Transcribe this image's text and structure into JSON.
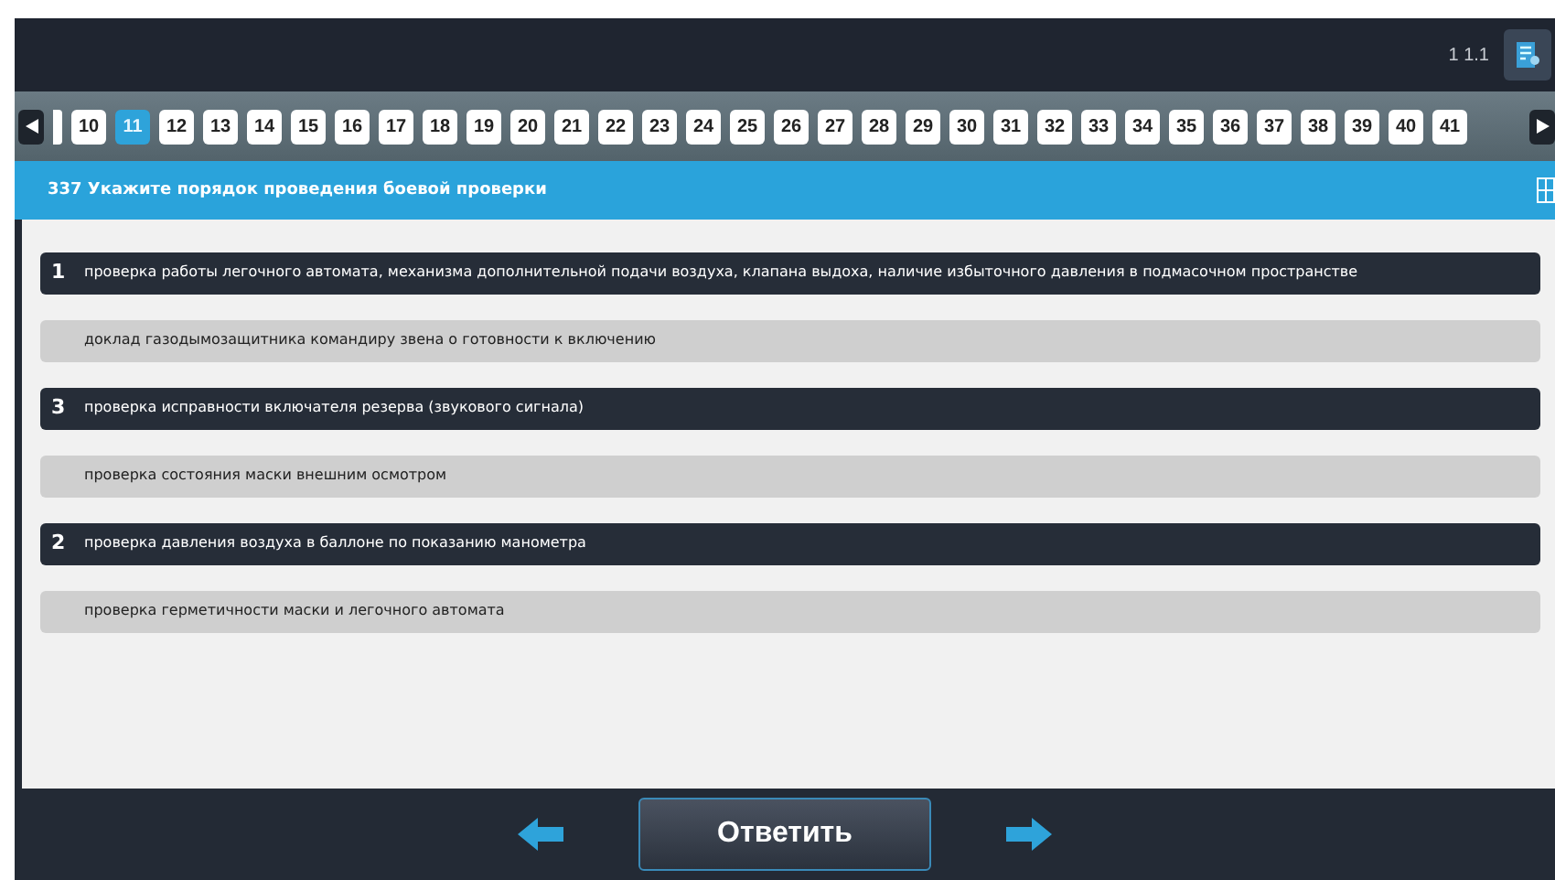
{
  "header": {
    "version": "1 1.1"
  },
  "pager": {
    "pages": [
      {
        "label": "10",
        "selected": false
      },
      {
        "label": "11",
        "selected": true
      },
      {
        "label": "12",
        "selected": false
      },
      {
        "label": "13",
        "selected": false
      },
      {
        "label": "14",
        "selected": false
      },
      {
        "label": "15",
        "selected": false
      },
      {
        "label": "16",
        "selected": false
      },
      {
        "label": "17",
        "selected": false
      },
      {
        "label": "18",
        "selected": false
      },
      {
        "label": "19",
        "selected": false
      },
      {
        "label": "20",
        "selected": false
      },
      {
        "label": "21",
        "selected": false
      },
      {
        "label": "22",
        "selected": false
      },
      {
        "label": "23",
        "selected": false
      },
      {
        "label": "24",
        "selected": false
      },
      {
        "label": "25",
        "selected": false
      },
      {
        "label": "26",
        "selected": false
      },
      {
        "label": "27",
        "selected": false
      },
      {
        "label": "28",
        "selected": false
      },
      {
        "label": "29",
        "selected": false
      },
      {
        "label": "30",
        "selected": false
      },
      {
        "label": "31",
        "selected": false
      },
      {
        "label": "32",
        "selected": false
      },
      {
        "label": "33",
        "selected": false
      },
      {
        "label": "34",
        "selected": false
      },
      {
        "label": "35",
        "selected": false
      },
      {
        "label": "36",
        "selected": false
      },
      {
        "label": "37",
        "selected": false
      },
      {
        "label": "38",
        "selected": false
      },
      {
        "label": "39",
        "selected": false
      },
      {
        "label": "40",
        "selected": false
      },
      {
        "label": "41",
        "selected": false
      }
    ]
  },
  "question": {
    "title": "337 Укажите порядок проведения боевой проверки"
  },
  "answers": [
    {
      "text": "проверка работы легочного автомата, механизма дополнительной подачи воздуха, клапана выдоха, наличие избыточного давления в подмасочном пространстве",
      "selected": true,
      "order": "1"
    },
    {
      "text": "доклад газодымозащитника командиру звена о готовности к включению",
      "selected": false
    },
    {
      "text": "проверка исправности включателя резерва (звукового сигнала)",
      "selected": true,
      "order": "3"
    },
    {
      "text": "проверка состояния маски внешним осмотром",
      "selected": false
    },
    {
      "text": "проверка давления воздуха в баллоне по показанию манометра",
      "selected": true,
      "order": "2"
    },
    {
      "text": "проверка герметичности маски и легочного автомата",
      "selected": false
    }
  ],
  "footer": {
    "submit": "Ответить"
  }
}
